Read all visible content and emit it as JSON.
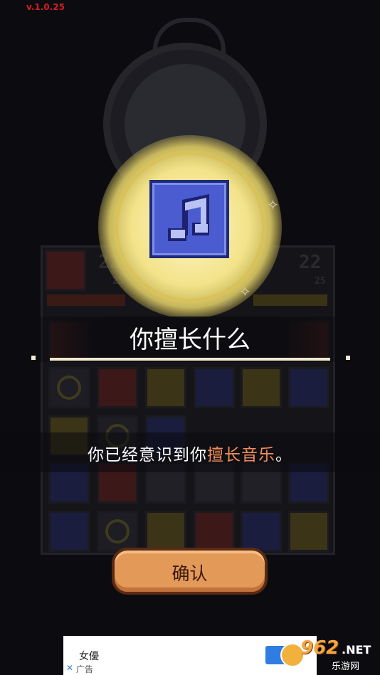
{
  "version_label": "v.1.0.25",
  "scene": {
    "score_left": "22",
    "score_left_sub": "25",
    "score_right": "22",
    "score_right_sub": "25"
  },
  "popup": {
    "badge_icon": "music-note-icon",
    "title": "你擅长什么",
    "message_prefix": "你已经意识到你",
    "message_highlight": "擅长音乐",
    "message_suffix": "。",
    "confirm_label": "确认"
  },
  "ad": {
    "advertiser": "女優",
    "label": "广告"
  },
  "watermark": {
    "number": "962",
    "suffix": ".NET",
    "cn": "乐游网"
  },
  "colors": {
    "highlight": "#f08d5a",
    "button": "#e39a59",
    "badge": "#4a5ccf"
  }
}
